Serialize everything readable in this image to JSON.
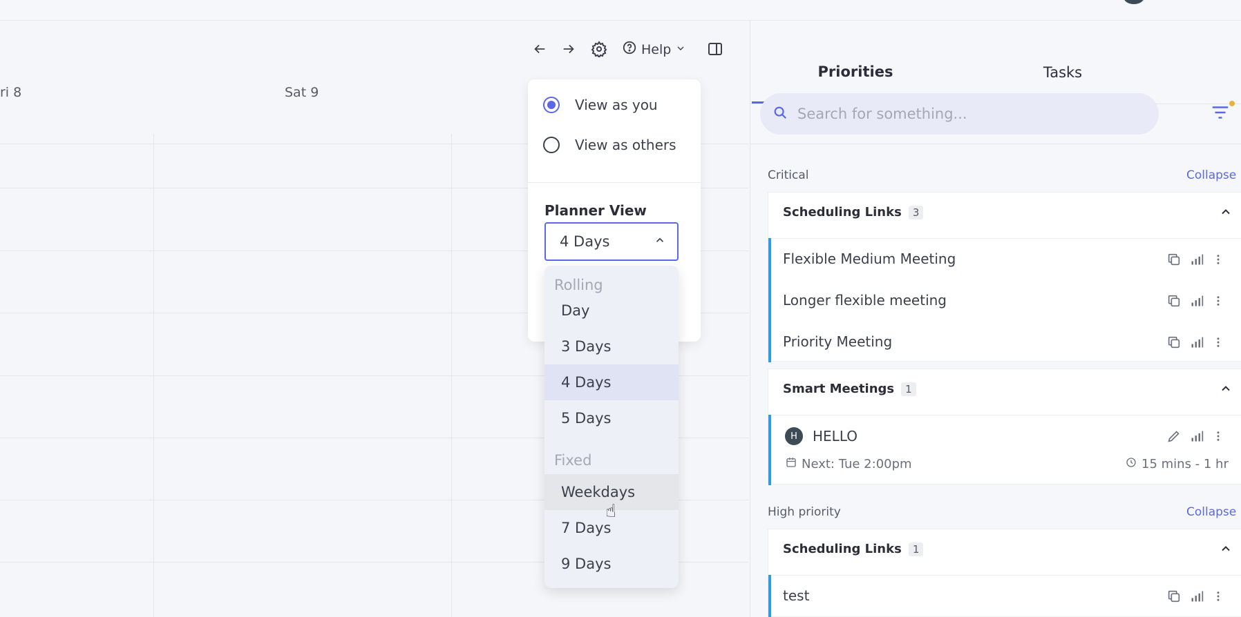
{
  "calendar": {
    "day_labels": [
      "ri 8",
      "Sat 9"
    ]
  },
  "toolbar": {
    "help_label": "Help"
  },
  "view_popover": {
    "options": [
      "View as you",
      "View as others"
    ],
    "selected_option": "View as you",
    "planner_view_title": "Planner View",
    "planner_view_value": "4 Days"
  },
  "dropdown": {
    "groups": [
      {
        "label": "Rolling",
        "items": [
          "Day",
          "3 Days",
          "4 Days",
          "5 Days"
        ]
      },
      {
        "label": "Fixed",
        "items": [
          "Weekdays",
          "7 Days",
          "9 Days"
        ]
      }
    ],
    "selected": "4 Days",
    "hovered": "Weekdays"
  },
  "panel": {
    "tabs": [
      "Priorities",
      "Tasks"
    ],
    "active_tab": "Priorities",
    "search_placeholder": "Search for something...",
    "sections": [
      {
        "label": "Critical",
        "collapse_label": "Collapse",
        "groups": [
          {
            "title": "Scheduling Links",
            "count": "3",
            "items": [
              "Flexible Medium Meeting",
              "Longer flexible meeting",
              "Priority Meeting"
            ]
          },
          {
            "title": "Smart Meetings",
            "count": "1",
            "meeting": {
              "avatar": "H",
              "name": "HELLO",
              "next": "Next: Tue 2:00pm",
              "duration": "15 mins - 1 hr"
            }
          }
        ]
      },
      {
        "label": "High priority",
        "collapse_label": "Collapse",
        "groups": [
          {
            "title": "Scheduling Links",
            "count": "1",
            "items": [
              "test"
            ]
          }
        ]
      }
    ]
  },
  "colors": {
    "accent": "#5b67e6",
    "item_bar": "#2b9de0",
    "filter_dot": "#e8b33b"
  }
}
